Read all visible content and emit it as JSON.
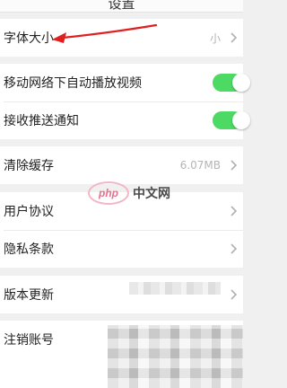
{
  "header": {
    "title": "设置"
  },
  "settings": {
    "font_size": {
      "label": "字体大小",
      "value": "小"
    },
    "autoplay": {
      "label": "移动网络下自动播放视频",
      "enabled": true
    },
    "push": {
      "label": "接收推送通知",
      "enabled": true
    },
    "cache": {
      "label": "清除缓存",
      "value": "6.07MB"
    },
    "agreement": {
      "label": "用户协议"
    },
    "privacy": {
      "label": "隐私条款"
    },
    "update": {
      "label": "版本更新"
    },
    "cancel_account": {
      "label": "注销账号"
    }
  },
  "watermark": {
    "logo": "php",
    "text": "中文网"
  },
  "colors": {
    "toggle_on": "#4cd964",
    "annotation_arrow": "#e02020"
  }
}
